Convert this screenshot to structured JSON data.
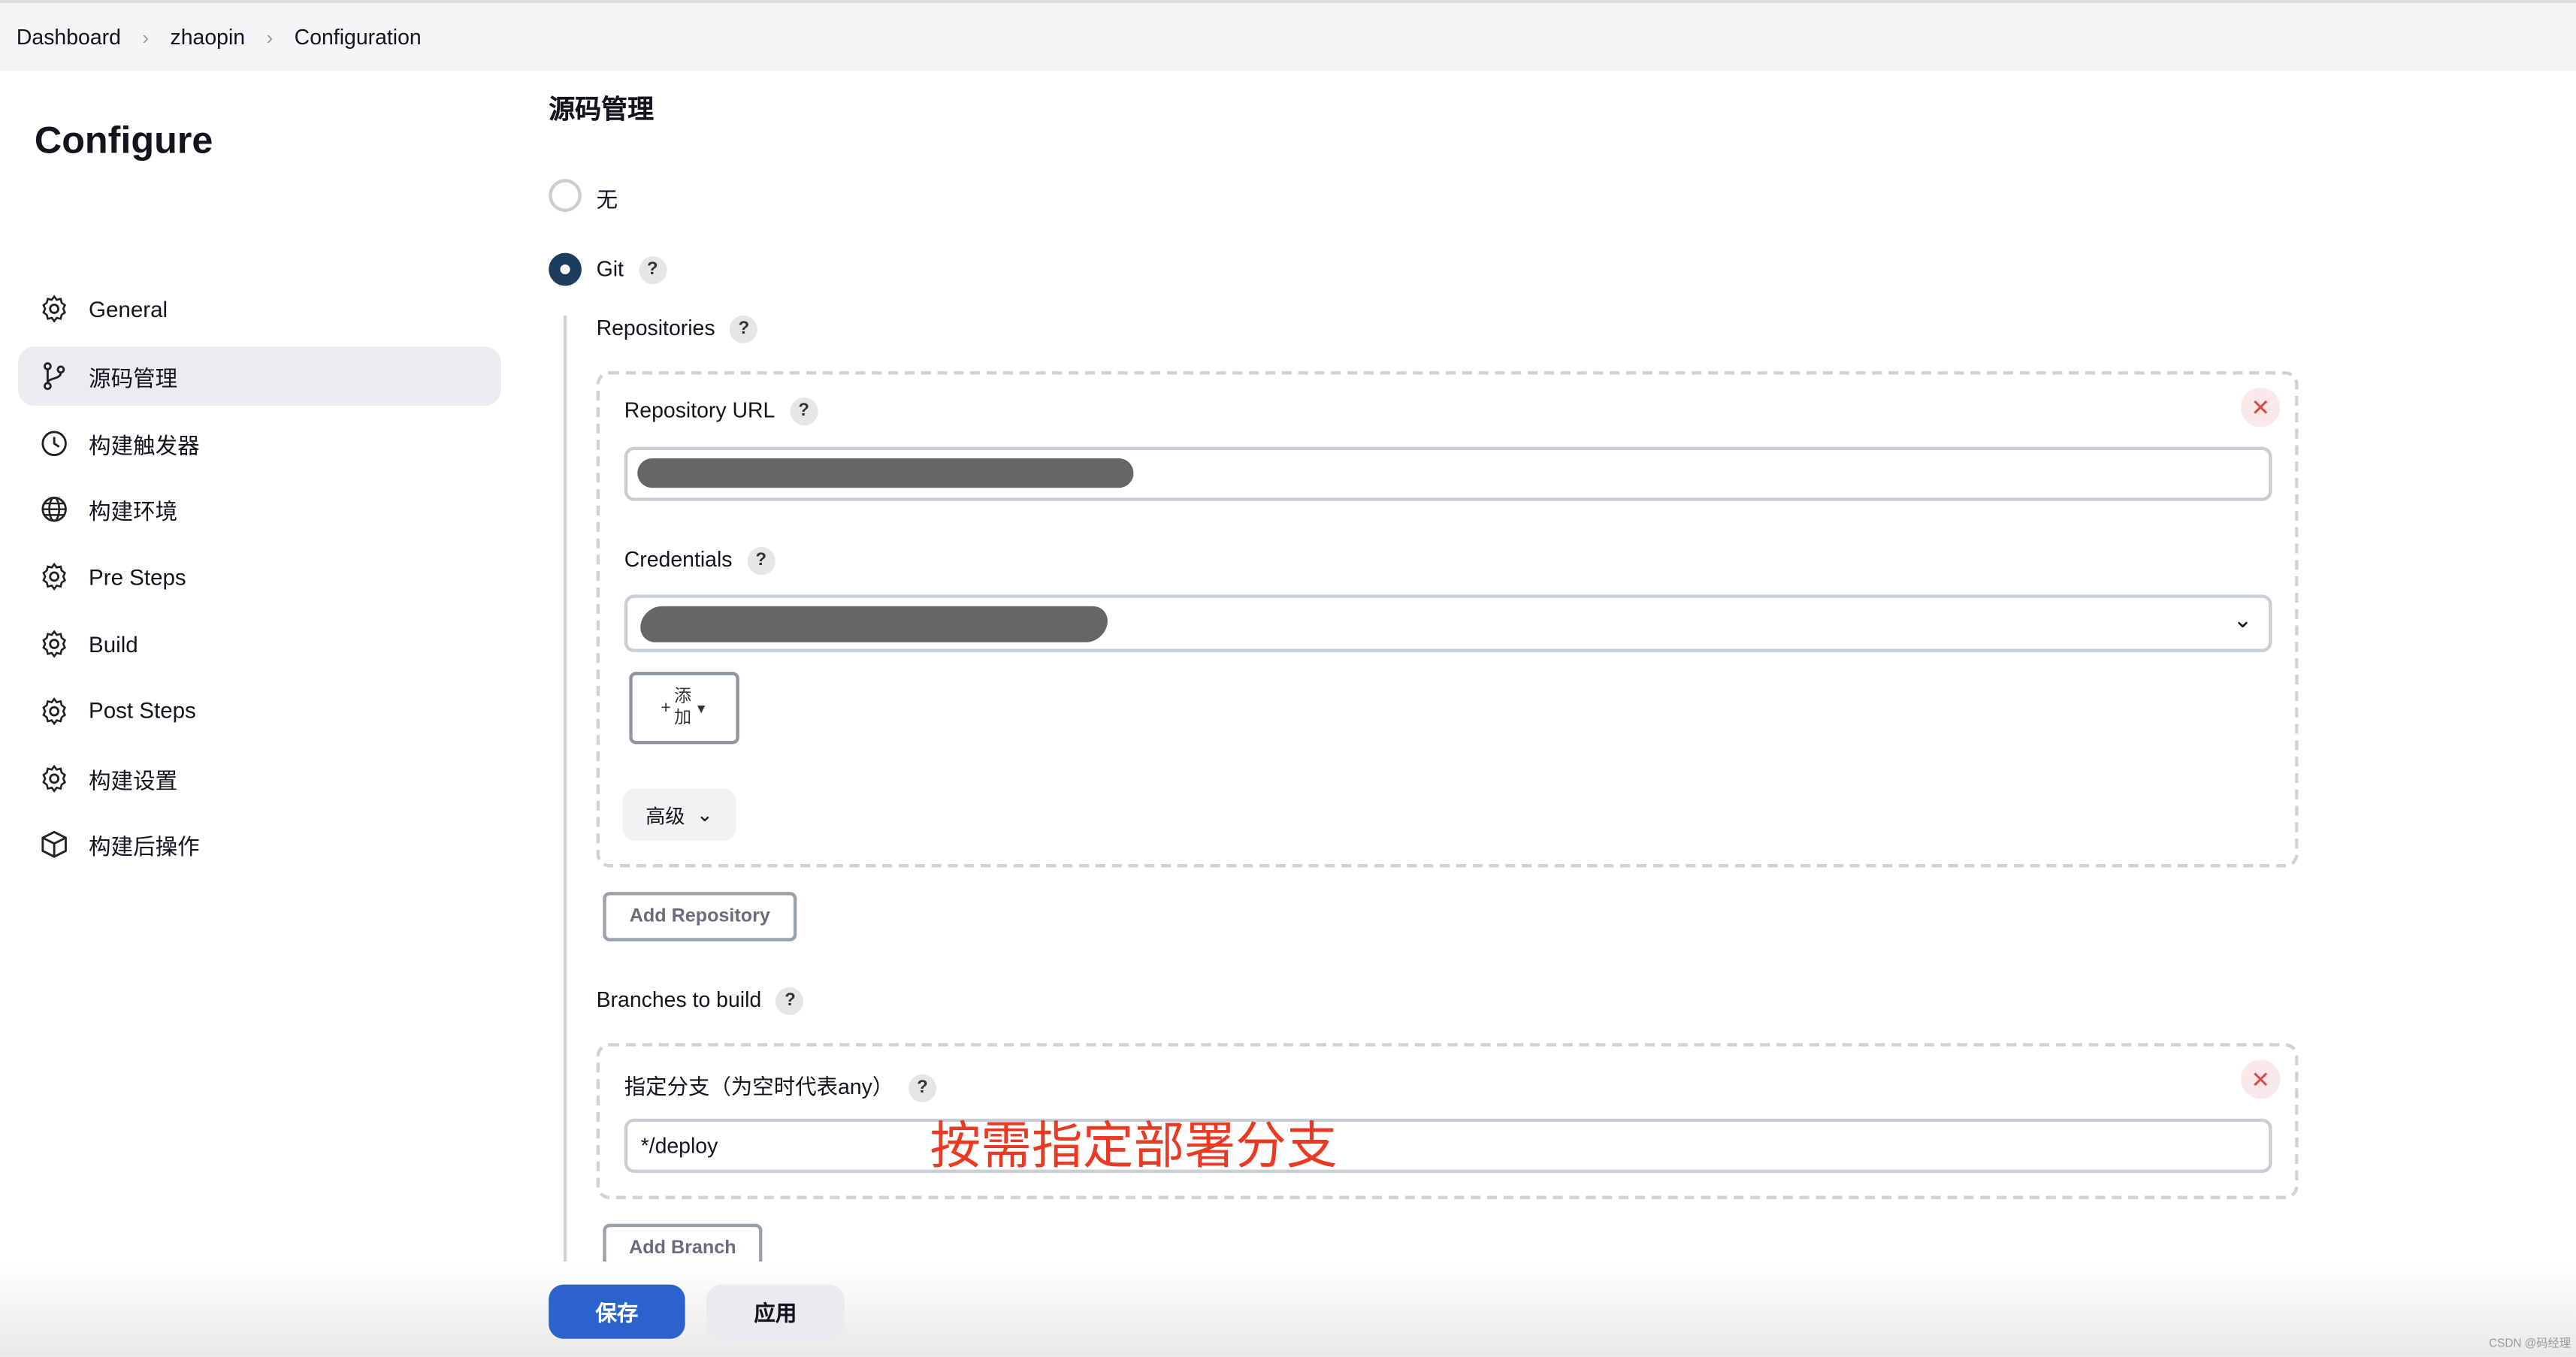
{
  "breadcrumb": [
    "Dashboard",
    "zhaopin",
    "Configuration"
  ],
  "sidebar": {
    "title": "Configure",
    "items": [
      {
        "label": "General",
        "icon": "gear-icon",
        "active": false
      },
      {
        "label": "源码管理",
        "icon": "git-branch-icon",
        "active": true
      },
      {
        "label": "构建触发器",
        "icon": "clock-icon",
        "active": false
      },
      {
        "label": "构建环境",
        "icon": "globe-icon",
        "active": false
      },
      {
        "label": "Pre Steps",
        "icon": "gear-icon",
        "active": false
      },
      {
        "label": "Build",
        "icon": "gear-icon",
        "active": false
      },
      {
        "label": "Post Steps",
        "icon": "gear-icon",
        "active": false
      },
      {
        "label": "构建设置",
        "icon": "gear-icon",
        "active": false
      },
      {
        "label": "构建后操作",
        "icon": "package-icon",
        "active": false
      }
    ]
  },
  "main": {
    "section_title": "源码管理",
    "scm_options": [
      {
        "label": "无",
        "selected": false
      },
      {
        "label": "Git",
        "selected": true
      }
    ],
    "help": "?",
    "repositories_label": "Repositories",
    "repo_url_label": "Repository URL",
    "credentials_label": "Credentials",
    "add_button": {
      "line1": "添",
      "line2": "加"
    },
    "advanced_label": "高级",
    "add_repository": "Add Repository",
    "branches_label": "Branches to build",
    "branch_specifier_label": "指定分支（为空时代表any）",
    "branch_value": "*/deploy",
    "annotation": "按需指定部署分支",
    "add_branch": "Add Branch"
  },
  "footer": {
    "save": "保存",
    "apply": "应用"
  },
  "watermark": "CSDN @码经理",
  "colors": {
    "primary": "#2b62cb",
    "annotation": "#ea3a23",
    "radio": "#1c3d5e"
  }
}
